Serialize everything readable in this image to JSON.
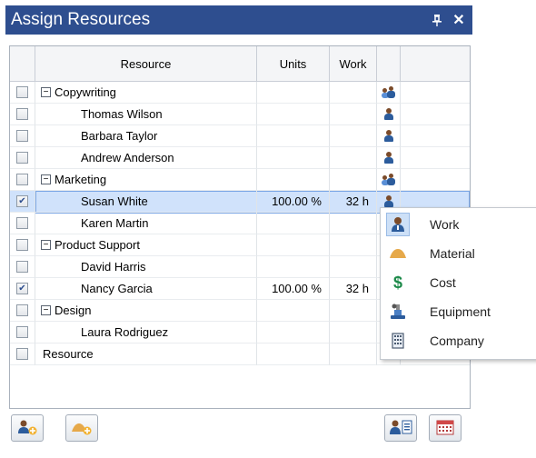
{
  "panel": {
    "title": "Assign Resources",
    "pin_glyph": "И",
    "close_glyph": "✕"
  },
  "columns": {
    "resource": "Resource",
    "units": "Units",
    "work": "Work"
  },
  "rows": [
    {
      "kind": "group",
      "label": "Copywriting",
      "checked": false,
      "units": "",
      "work": "",
      "icon": "group-icon"
    },
    {
      "kind": "child",
      "label": "Thomas Wilson",
      "checked": false,
      "units": "",
      "work": "",
      "icon": "person-icon"
    },
    {
      "kind": "child",
      "label": "Barbara Taylor",
      "checked": false,
      "units": "",
      "work": "",
      "icon": "person-icon"
    },
    {
      "kind": "child",
      "label": "Andrew Anderson",
      "checked": false,
      "units": "",
      "work": "",
      "icon": "person-icon"
    },
    {
      "kind": "group",
      "label": "Marketing",
      "checked": false,
      "units": "",
      "work": "",
      "icon": "group-icon"
    },
    {
      "kind": "child",
      "label": "Susan White",
      "checked": true,
      "units": "100.00 %",
      "work": "32 h",
      "icon": "person-icon",
      "selected": true
    },
    {
      "kind": "child",
      "label": "Karen Martin",
      "checked": false,
      "units": "",
      "work": "",
      "icon": ""
    },
    {
      "kind": "group",
      "label": "Product Support",
      "checked": false,
      "units": "",
      "work": "",
      "icon": ""
    },
    {
      "kind": "child",
      "label": "David Harris",
      "checked": false,
      "units": "",
      "work": "",
      "icon": ""
    },
    {
      "kind": "child",
      "label": "Nancy Garcia",
      "checked": true,
      "units": "100.00 %",
      "work": "32 h",
      "icon": ""
    },
    {
      "kind": "group",
      "label": "Design",
      "checked": false,
      "units": "",
      "work": "",
      "icon": ""
    },
    {
      "kind": "child",
      "label": "Laura Rodriguez",
      "checked": false,
      "units": "",
      "work": "",
      "icon": ""
    },
    {
      "kind": "root",
      "label": "Resource",
      "checked": false,
      "units": "",
      "work": "",
      "icon": ""
    }
  ],
  "type_menu": [
    {
      "label": "Work",
      "icon": "work-person-icon",
      "highlighted": true
    },
    {
      "label": "Material",
      "icon": "material-pile-icon"
    },
    {
      "label": "Cost",
      "icon": "dollar-icon"
    },
    {
      "label": "Equipment",
      "icon": "equipment-icon"
    },
    {
      "label": "Company",
      "icon": "company-building-icon"
    }
  ],
  "toolbar": {
    "add_work_resource": "add-work-resource-icon",
    "add_material_resource": "add-material-resource-icon",
    "resource_list": "resource-list-icon",
    "calendar": "calendar-icon"
  },
  "colors": {
    "title_bar": "#2e4e8f",
    "selected_row": "#d0e2fb",
    "selected_border": "#7aa6e6",
    "checkmark": "#2e4e8f"
  }
}
